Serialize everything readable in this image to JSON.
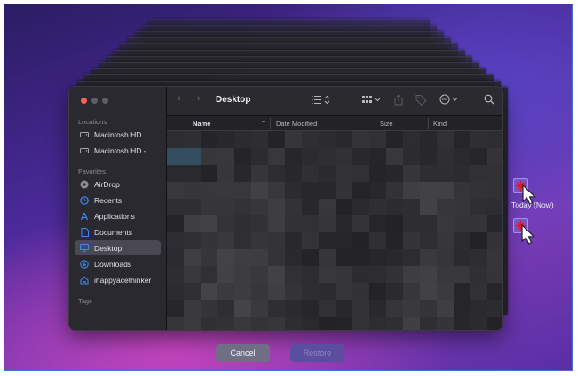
{
  "finder": {
    "title": "Desktop",
    "sections": {
      "locations": "Locations",
      "favorites": "Favorites",
      "tags": "Tags"
    },
    "locations": [
      {
        "label": "Macintosh HD",
        "icon": "disk-icon"
      },
      {
        "label": "Macintosh HD -...",
        "icon": "disk-icon"
      }
    ],
    "favorites": [
      {
        "label": "AirDrop",
        "icon": "airdrop-icon"
      },
      {
        "label": "Recents",
        "icon": "clock-icon"
      },
      {
        "label": "Applications",
        "icon": "applications-icon"
      },
      {
        "label": "Documents",
        "icon": "document-icon"
      },
      {
        "label": "Desktop",
        "icon": "desktop-icon",
        "selected": true
      },
      {
        "label": "Downloads",
        "icon": "download-icon"
      },
      {
        "label": "ihappyacethinker",
        "icon": "home-icon"
      }
    ],
    "columns": {
      "name": "Name",
      "date_modified": "Date Modified",
      "size": "Size",
      "kind": "Kind"
    }
  },
  "timeline": {
    "label": "Today (Now)"
  },
  "buttons": {
    "cancel": "Cancel",
    "restore": "Restore"
  },
  "colors": {
    "accent": "#3d8af7",
    "close": "#ff5f57",
    "minimize": "#5f5e64",
    "zoom": "#5f5e64",
    "cancel_bg": "#6f6e84",
    "restore_bg": "#5b4ea0"
  }
}
